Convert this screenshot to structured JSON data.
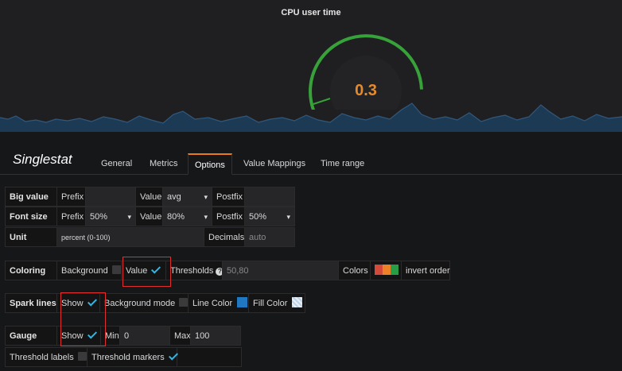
{
  "panel": {
    "title": "CPU user time",
    "value": "0.3",
    "value_color": "#e88a2b",
    "gauge_color": "#37a13a",
    "gauge_fraction": 0.9,
    "spark_color": "#31587c"
  },
  "editor": {
    "title": "Singlestat",
    "tabs": [
      "General",
      "Metrics",
      "Options",
      "Value Mappings",
      "Time range"
    ],
    "active_tab": "Options"
  },
  "big_value": {
    "header": "Big value",
    "prefix_label": "Prefix",
    "prefix_value": "",
    "value_label": "Value",
    "value_value": "avg",
    "postfix_label": "Postfix",
    "postfix_value": ""
  },
  "font_size": {
    "header": "Font size",
    "prefix_label": "Prefix",
    "prefix_value": "50%",
    "value_label": "Value",
    "value_value": "80%",
    "postfix_label": "Postfix",
    "postfix_value": "50%"
  },
  "unit": {
    "header": "Unit",
    "value": "percent (0-100)",
    "decimals_label": "Decimals",
    "decimals_placeholder": "auto"
  },
  "coloring": {
    "header": "Coloring",
    "background_label": "Background",
    "background_checked": false,
    "value_label": "Value",
    "value_checked": true,
    "thresholds_label": "Thresholds",
    "thresholds_value": "50,80",
    "colors_label": "Colors",
    "colors": [
      "#d44a3a",
      "#ed8128",
      "#299c46"
    ],
    "invert_label": "invert order"
  },
  "spark_lines": {
    "header": "Spark lines",
    "show_label": "Show",
    "show_checked": true,
    "background_mode_label": "Background mode",
    "background_mode_checked": false,
    "line_color_label": "Line Color",
    "line_color": "#1f78c1",
    "fill_color_label": "Fill Color"
  },
  "gauge": {
    "header": "Gauge",
    "show_label": "Show",
    "show_checked": true,
    "min_label": "Min",
    "min_value": "0",
    "max_label": "Max",
    "max_value": "100",
    "threshold_labels_label": "Threshold labels",
    "threshold_labels_checked": false,
    "threshold_markers_label": "Threshold markers",
    "threshold_markers_checked": true
  }
}
